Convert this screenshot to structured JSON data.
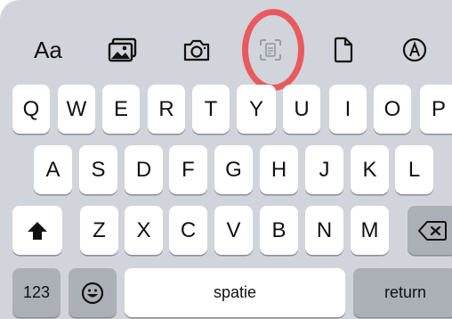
{
  "toolbar": {
    "items": [
      {
        "name": "text-format",
        "label": "Aa"
      },
      {
        "name": "photo-library-icon"
      },
      {
        "name": "camera-icon"
      },
      {
        "name": "scan-text-icon"
      },
      {
        "name": "document-icon"
      },
      {
        "name": "markup-pen-icon"
      }
    ],
    "highlight_color": "#e85a5e"
  },
  "keyboard": {
    "row1": [
      "Q",
      "W",
      "E",
      "R",
      "T",
      "Y",
      "U",
      "I",
      "O",
      "P"
    ],
    "row2": [
      "A",
      "S",
      "D",
      "F",
      "G",
      "H",
      "J",
      "K",
      "L"
    ],
    "row3": [
      "Z",
      "X",
      "C",
      "V",
      "B",
      "N",
      "M"
    ],
    "numbers_label": "123",
    "space_label": "spatie",
    "return_label": "return",
    "shift_icon": "shift-icon",
    "delete_icon": "delete-icon",
    "emoji_icon": "emoji-icon"
  }
}
